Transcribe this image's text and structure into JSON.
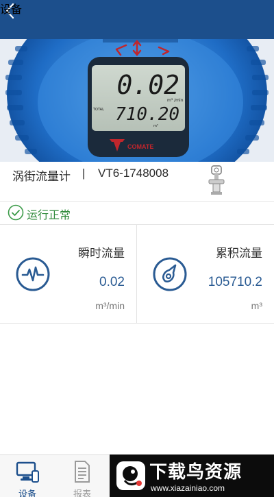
{
  "header": {
    "title": "设备"
  },
  "hero": {
    "lcd_rate": "0.02",
    "lcd_rate_unit": "m³ /min",
    "lcd_total_label": "TOTAL",
    "lcd_total": "710.20",
    "lcd_total_unit": "m³",
    "brand": "COMATE"
  },
  "device": {
    "name": "涡街流量计",
    "separator": "|",
    "id": "VT6-1748008"
  },
  "status": {
    "text": "运行正常",
    "color": "#2f8a3b"
  },
  "metrics": [
    {
      "label": "瞬时流量",
      "value": "0.02",
      "unit": "m³/min",
      "icon": "pulse-wave-icon"
    },
    {
      "label": "累积流量",
      "value": "105710.2",
      "unit": "m³",
      "icon": "volume-gauge-icon"
    }
  ],
  "tabs": [
    {
      "label": "设备",
      "icon": "monitor-phone-icon",
      "active": true
    },
    {
      "label": "报表",
      "icon": "report-document-icon",
      "active": false
    }
  ],
  "watermark": {
    "title": "下载鸟资源",
    "url": "www.xiazainiao.com"
  },
  "colors": {
    "primary": "#1c4f8c",
    "accent_blue": "#2a5b93",
    "status_green": "#2f8a3b"
  }
}
